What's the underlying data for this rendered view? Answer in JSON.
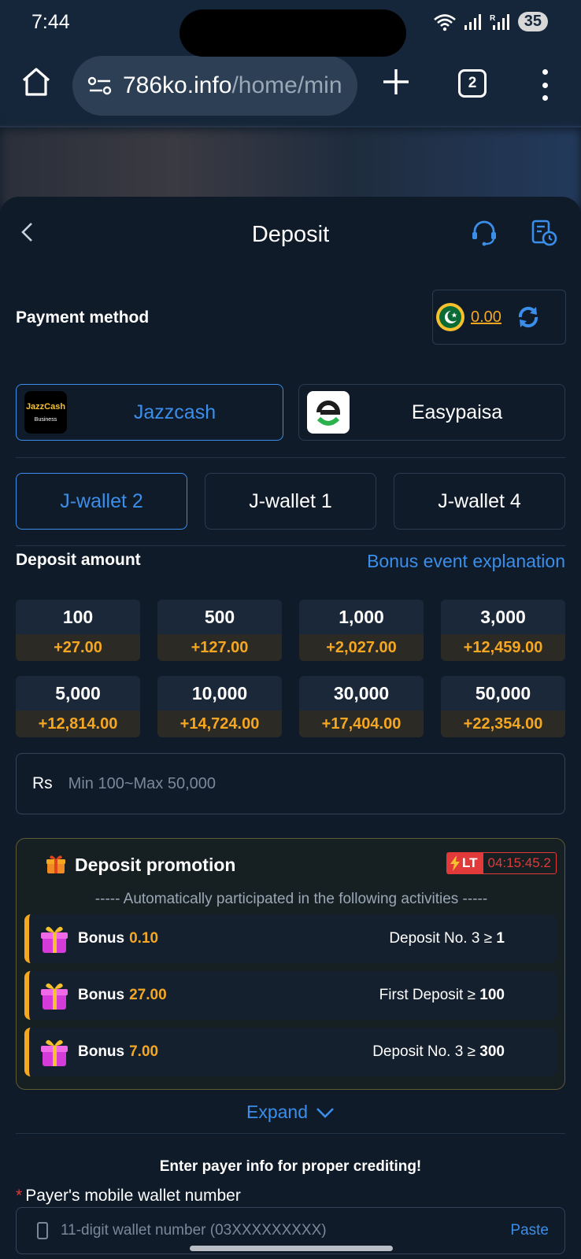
{
  "status_bar": {
    "time": "7:44",
    "battery": "35"
  },
  "browser": {
    "url_domain": "786ko.info",
    "url_path": "/home/min",
    "tab_count": "2"
  },
  "header": {
    "title": "Deposit"
  },
  "payment": {
    "label": "Payment method",
    "balance": "0.00",
    "methods": [
      {
        "label": "Jazzcash",
        "logo_text": "JazzCash",
        "logo_sub": "Business",
        "active": true
      },
      {
        "label": "Easypaisa",
        "active": false
      }
    ],
    "wallets": [
      {
        "label": "J-wallet 2",
        "active": true
      },
      {
        "label": "J-wallet 1",
        "active": false
      },
      {
        "label": "J-wallet 4",
        "active": false
      }
    ]
  },
  "deposit": {
    "label": "Deposit amount",
    "bonus_link": "Bonus event explanation",
    "amounts": [
      {
        "value": "100",
        "bonus": "+27.00"
      },
      {
        "value": "500",
        "bonus": "+127.00"
      },
      {
        "value": "1,000",
        "bonus": "+2,027.00"
      },
      {
        "value": "3,000",
        "bonus": "+12,459.00"
      },
      {
        "value": "5,000",
        "bonus": "+12,814.00"
      },
      {
        "value": "10,000",
        "bonus": "+14,724.00"
      },
      {
        "value": "30,000",
        "bonus": "+17,404.00"
      },
      {
        "value": "50,000",
        "bonus": "+22,354.00"
      }
    ],
    "currency": "Rs",
    "input_placeholder": "Min 100~Max 50,000"
  },
  "promotion": {
    "title": "Deposit promotion",
    "badge": "LT",
    "timer": "04:15:45.2",
    "subtitle": "----- Automatically participated in the following activities -----",
    "rows": [
      {
        "word": "Bonus",
        "amount": "0.10",
        "condition": "Deposit No. 3 ≥",
        "threshold": "1"
      },
      {
        "word": "Bonus",
        "amount": "27.00",
        "condition": "First Deposit ≥",
        "threshold": "100"
      },
      {
        "word": "Bonus",
        "amount": "7.00",
        "condition": "Deposit No. 3 ≥",
        "threshold": "300"
      }
    ],
    "expand_label": "Expand"
  },
  "payer": {
    "note": "Enter payer info for proper crediting!",
    "required_mark": "*",
    "label": "Payer's mobile wallet number",
    "placeholder": "11-digit wallet number (03XXXXXXXXX)",
    "paste_label": "Paste"
  }
}
